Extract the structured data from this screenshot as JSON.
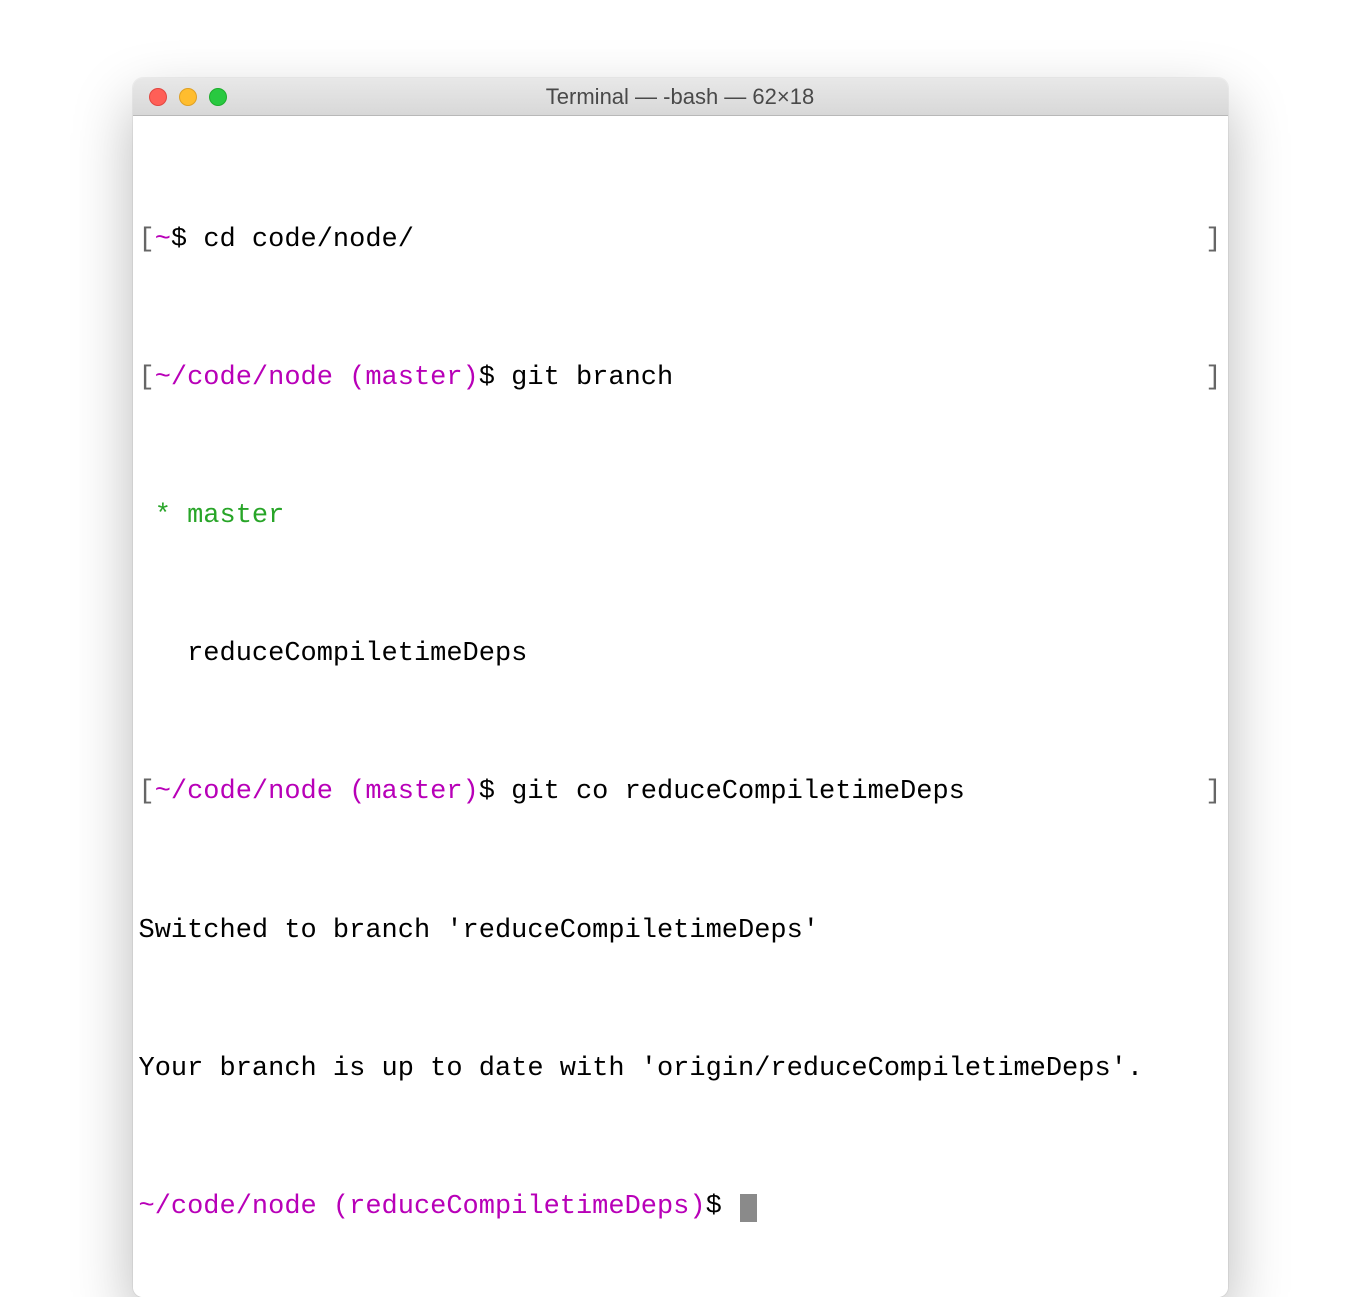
{
  "window": {
    "title": "Terminal — -bash — 62×18"
  },
  "session": {
    "line1": {
      "left_bracket": "[",
      "path": "~",
      "dollar": "$ ",
      "cmd": "cd code/node/",
      "right_bracket": "]"
    },
    "line2": {
      "left_bracket": "[",
      "path": "~/code/node (master)",
      "dollar": "$ ",
      "cmd": "git branch",
      "right_bracket": "]"
    },
    "line3": {
      "star": " * ",
      "branch": "master"
    },
    "line4": {
      "indent": "   ",
      "branch": "reduceCompiletimeDeps"
    },
    "line5": {
      "left_bracket": "[",
      "path": "~/code/node (master)",
      "dollar": "$ ",
      "cmd": "git co reduceCompiletimeDeps",
      "right_bracket": "]"
    },
    "line6": {
      "text": "Switched to branch 'reduceCompiletimeDeps'"
    },
    "line7": {
      "text": "Your branch is up to date with 'origin/reduceCompiletimeDeps'."
    },
    "line8": {
      "path": "~/code/node (reduceCompiletimeDeps)",
      "dollar": "$ "
    }
  }
}
